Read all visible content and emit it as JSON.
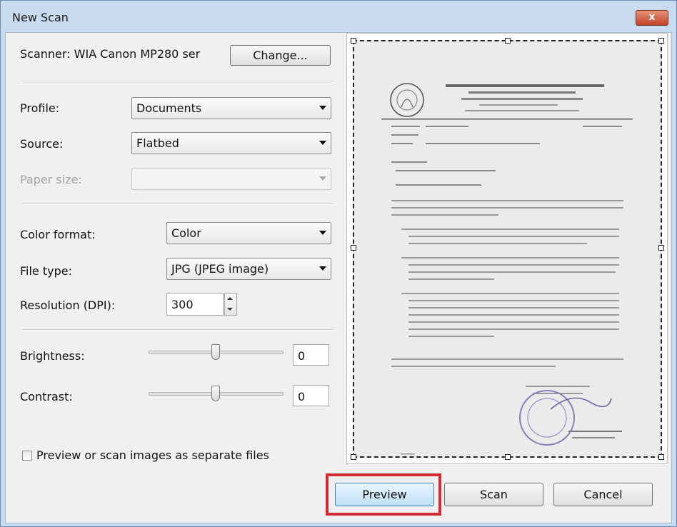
{
  "window": {
    "title": "New Scan",
    "close_label": "x"
  },
  "scanner": {
    "label": "Scanner: WIA Canon MP280 ser",
    "change_label": "Change..."
  },
  "profile": {
    "label": "Profile:",
    "value": "Documents"
  },
  "source": {
    "label": "Source:",
    "value": "Flatbed"
  },
  "paper_size": {
    "label": "Paper size:",
    "value": ""
  },
  "color_format": {
    "label": "Color format:",
    "value": "Color"
  },
  "file_type": {
    "label": "File type:",
    "value": "JPG (JPEG image)"
  },
  "resolution": {
    "label": "Resolution (DPI):",
    "value": "300"
  },
  "brightness": {
    "label": "Brightness:",
    "value": "0",
    "level_percent": 50
  },
  "contrast": {
    "label": "Contrast:",
    "value": "0",
    "level_percent": 50
  },
  "separate_files": {
    "label": "Preview or scan images as separate files",
    "checked": false
  },
  "buttons": {
    "preview": "Preview",
    "scan": "Scan",
    "cancel": "Cancel"
  },
  "colors": {
    "highlight": "#d32a35",
    "title_bar": "#c9dbef",
    "stamp": "#8a7ab8"
  }
}
